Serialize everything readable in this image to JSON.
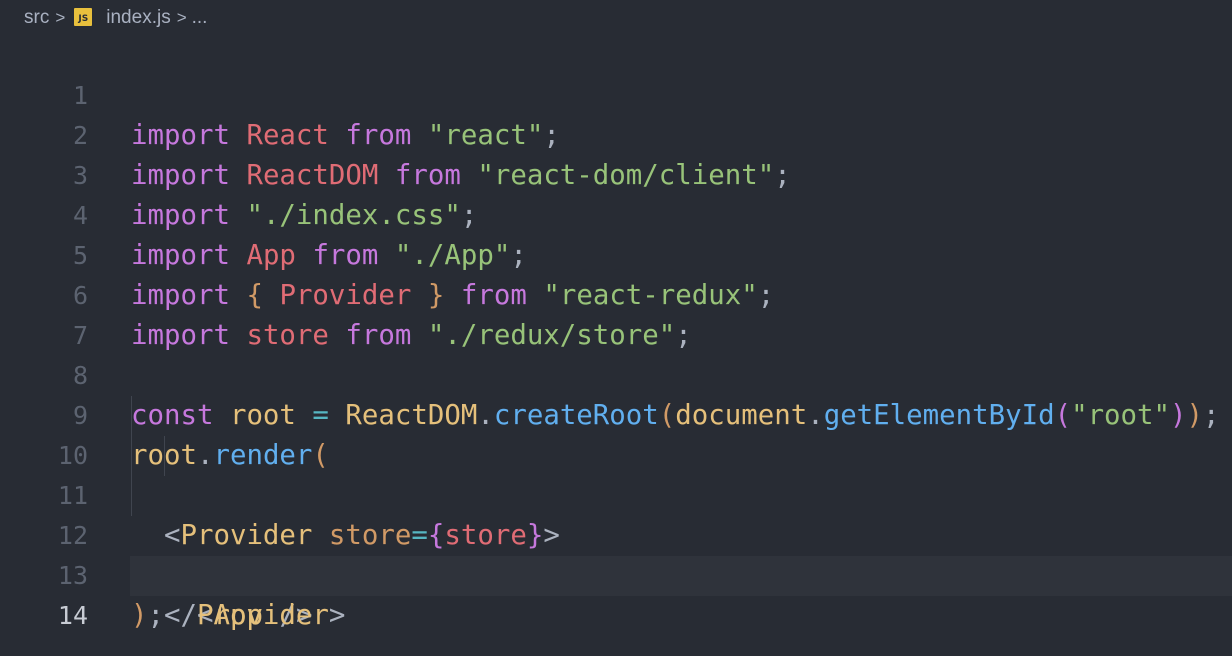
{
  "breadcrumb": {
    "folder": "src",
    "file_icon": "JS",
    "file": "index.js",
    "more": "..."
  },
  "line_numbers": [
    "1",
    "2",
    "3",
    "4",
    "5",
    "6",
    "7",
    "8",
    "9",
    "10",
    "11",
    "12",
    "13",
    "14"
  ],
  "active_line": "14",
  "code": {
    "l1": [
      "import",
      "React",
      "from",
      "\"react\"",
      ";"
    ],
    "l2": [
      "import",
      "ReactDOM",
      "from",
      "\"react-dom/client\"",
      ";"
    ],
    "l3": [
      "import",
      "\"./index.css\"",
      ";"
    ],
    "l4": [
      "import",
      "App",
      "from",
      "\"./App\"",
      ";"
    ],
    "l5": [
      "import",
      "{",
      "Provider",
      "}",
      "from",
      "\"react-redux\"",
      ";"
    ],
    "l6": [
      "import",
      "store",
      "from",
      "\"./redux/store\"",
      ";"
    ],
    "l8": [
      "const",
      "root",
      "=",
      "ReactDOM",
      ".",
      "createRoot",
      "(",
      "document",
      ".",
      "getElementById",
      "(",
      "\"root\"",
      ")",
      ")",
      ";"
    ],
    "l9": [
      "root",
      ".",
      "render",
      "("
    ],
    "l10": [
      "<",
      "Provider",
      "store",
      "=",
      "{",
      "store",
      "}",
      ">"
    ],
    "l11": [
      "<",
      "App",
      "/>"
    ],
    "l12": [
      "</",
      "Provider",
      ">"
    ],
    "l13": [
      ")",
      ";"
    ]
  }
}
